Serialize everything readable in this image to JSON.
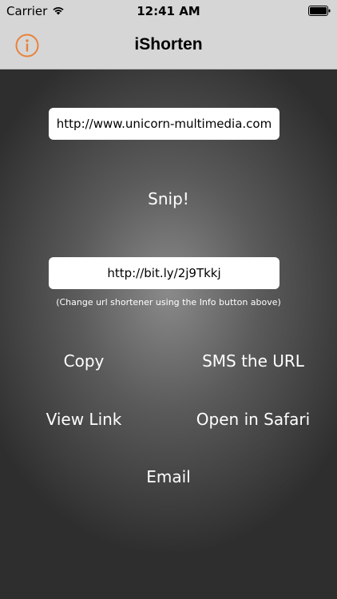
{
  "status_bar": {
    "carrier": "Carrier",
    "time": "12:41 AM"
  },
  "nav": {
    "title": "iShorten",
    "info_icon": "info-icon",
    "accent_color": "#e8823a"
  },
  "main": {
    "long_url": "http://www.unicorn-multimedia.com",
    "snip_label": "Snip!",
    "short_url": "http://bit.ly/2j9Tkkj",
    "hint": "(Change url shortener using the Info button above)",
    "actions": {
      "copy": "Copy",
      "sms": "SMS the URL",
      "view_link": "View Link",
      "open_safari": "Open in Safari",
      "email": "Email"
    }
  }
}
